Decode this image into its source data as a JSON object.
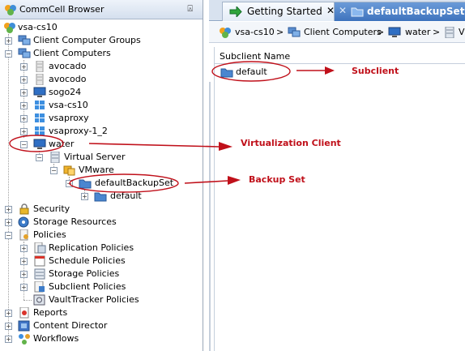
{
  "left_panel": {
    "title": "CommCell Browser",
    "pin": "⍓",
    "tree": [
      {
        "id": "root",
        "label": "vsa-cs10",
        "icon": "commcell-icon"
      },
      {
        "id": "client-groups",
        "label": "Client Computer Groups",
        "icon": "computer-group-icon"
      },
      {
        "id": "client-computers",
        "label": "Client Computers",
        "icon": "computer-group-icon"
      },
      {
        "id": "avocado",
        "label": "avocado",
        "icon": "server-icon"
      },
      {
        "id": "avocodo",
        "label": "avocodo",
        "icon": "server-icon"
      },
      {
        "id": "sogo24",
        "label": "sogo24",
        "icon": "monitor-icon"
      },
      {
        "id": "vsa-cs10",
        "label": "vsa-cs10",
        "icon": "windows-icon"
      },
      {
        "id": "vsaproxy",
        "label": "vsaproxy",
        "icon": "windows-icon"
      },
      {
        "id": "vsaproxy-1-2",
        "label": "vsaproxy-1_2",
        "icon": "windows-icon"
      },
      {
        "id": "water",
        "label": "water",
        "icon": "monitor-icon"
      },
      {
        "id": "virtual-server",
        "label": "Virtual Server",
        "icon": "server-icon"
      },
      {
        "id": "vmware",
        "label": "VMware",
        "icon": "vmware-icon"
      },
      {
        "id": "default-backup-set",
        "label": "defaultBackupSet",
        "icon": "folder-icon"
      },
      {
        "id": "default",
        "label": "default",
        "icon": "folder-icon"
      },
      {
        "id": "security",
        "label": "Security",
        "icon": "lock-icon"
      },
      {
        "id": "storage-resources",
        "label": "Storage Resources",
        "icon": "storage-icon"
      },
      {
        "id": "policies",
        "label": "Policies",
        "icon": "policy-icon"
      },
      {
        "id": "replication-policies",
        "label": "Replication Policies",
        "icon": "policy-icon"
      },
      {
        "id": "schedule-policies",
        "label": "Schedule Policies",
        "icon": "calendar-icon"
      },
      {
        "id": "storage-policies",
        "label": "Storage Policies",
        "icon": "storage-icon"
      },
      {
        "id": "subclient-policies",
        "label": "Subclient Policies",
        "icon": "policy-icon"
      },
      {
        "id": "vaulttracker-policies",
        "label": "VaultTracker Policies",
        "icon": "vault-icon"
      },
      {
        "id": "reports",
        "label": "Reports",
        "icon": "reports-icon"
      },
      {
        "id": "content-director",
        "label": "Content Director",
        "icon": "content-director-icon"
      },
      {
        "id": "workflows",
        "label": "Workflows",
        "icon": "workflow-icon"
      }
    ]
  },
  "tabs": [
    {
      "label": "Getting Started",
      "close": "✕"
    },
    {
      "label": "defaultBackupSet",
      "close": "✕"
    }
  ],
  "breadcrumb": {
    "items": [
      "vsa-cs10",
      "Client Computers",
      "water"
    ],
    "separator": ">",
    "overflow": "V"
  },
  "list": {
    "column_header": "Subclient Name",
    "rows": [
      "default"
    ]
  },
  "annotations": {
    "subclient": "Subclient",
    "virtualization_client": "Virtualization Client",
    "backup_set": "Backup Set"
  },
  "colors": {
    "annotation": "#c0101a",
    "tab_active": "#3e73bd",
    "folder": "#4a86d0"
  }
}
